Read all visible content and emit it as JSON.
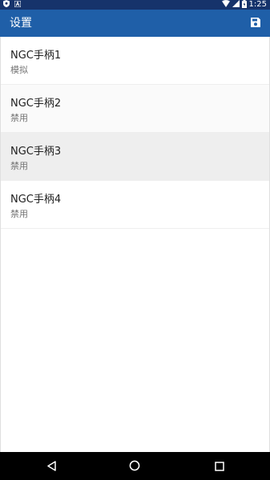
{
  "status_bar": {
    "time": "1:25",
    "icons": [
      "shield-icon",
      "font-icon",
      "wifi-icon",
      "signal-icon",
      "battery-icon"
    ]
  },
  "app_bar": {
    "title": "设置",
    "action_icon": "save-icon"
  },
  "list": {
    "items": [
      {
        "title": "NGC手柄1",
        "subtitle": "模拟"
      },
      {
        "title": "NGC手柄2",
        "subtitle": "禁用"
      },
      {
        "title": "NGC手柄3",
        "subtitle": "禁用"
      },
      {
        "title": "NGC手柄4",
        "subtitle": "禁用"
      }
    ]
  },
  "nav_bar": {
    "icons": [
      "back-icon",
      "home-icon",
      "recents-icon"
    ]
  },
  "colors": {
    "status_bar": "#16336b",
    "app_bar": "#1f5fa8",
    "nav_bar": "#000000",
    "selected_row": "#eeeeee"
  }
}
